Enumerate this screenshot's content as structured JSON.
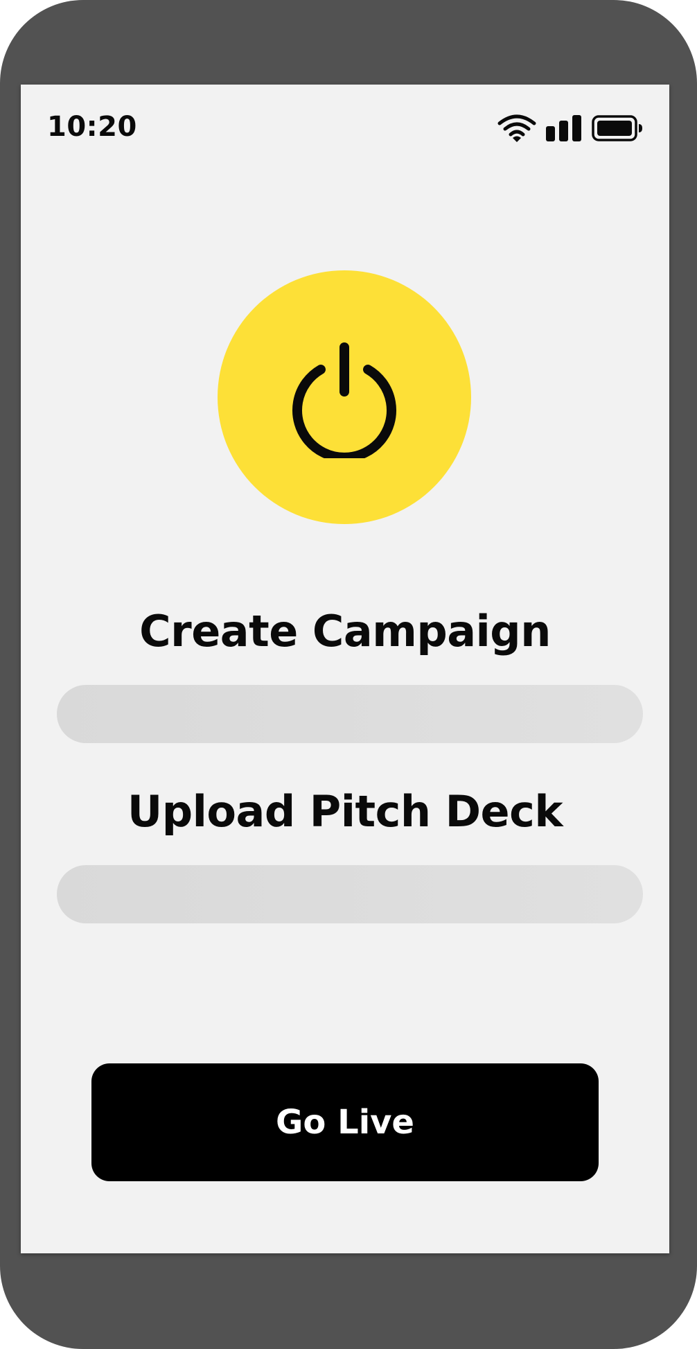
{
  "status_bar": {
    "time": "10:20",
    "icons": [
      "wifi-icon",
      "cellular-signal-icon",
      "battery-icon"
    ]
  },
  "hero": {
    "icon": "power-icon",
    "background_color": "#fde037"
  },
  "campaign_section": {
    "title": "Create Campaign",
    "input_value": "",
    "placeholder": ""
  },
  "pitch_deck_section": {
    "title": "Upload Pitch Deck",
    "input_value": "",
    "placeholder": ""
  },
  "primary_action": {
    "label": "Go Live",
    "background_color": "#000000",
    "text_color": "#ffffff"
  },
  "colors": {
    "device_frame": "#525252",
    "screen_background": "#f2f2f2",
    "field_background": "#dcdcdc"
  }
}
